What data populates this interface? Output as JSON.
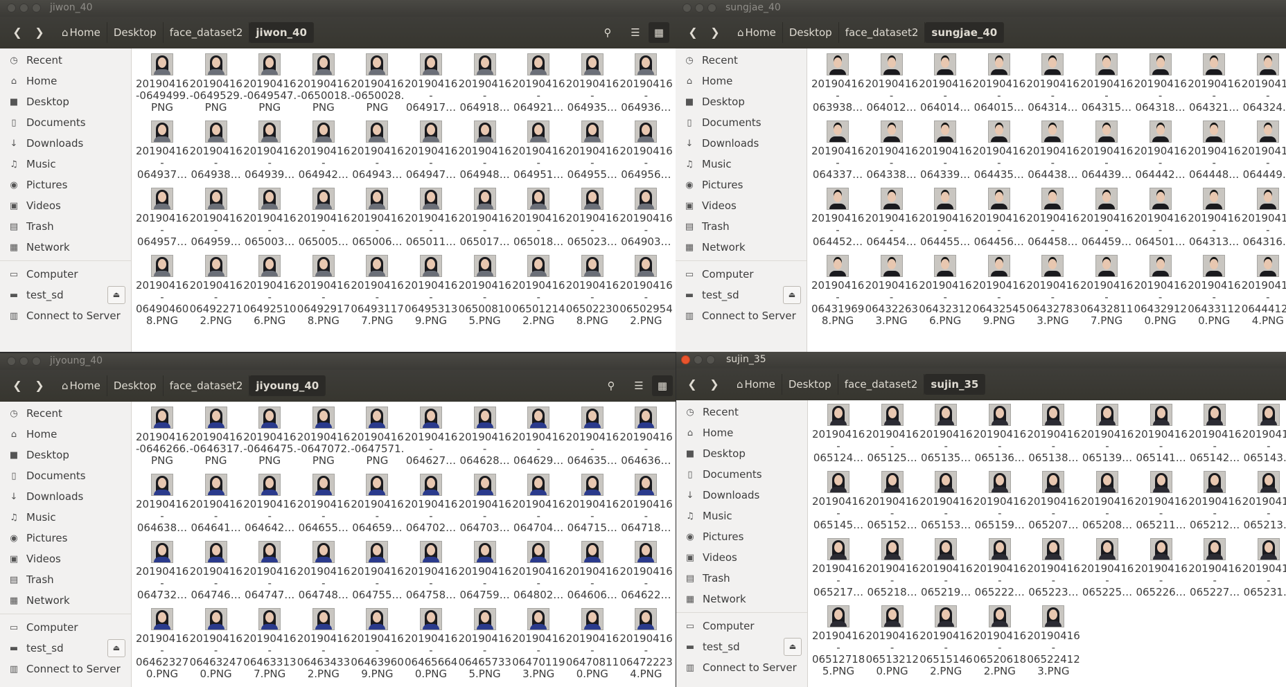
{
  "common": {
    "home_label": "Home",
    "desktop_label": "Desktop",
    "dataset_label": "face_dataset2",
    "sidebar": [
      "Recent",
      "Home",
      "Desktop",
      "Documents",
      "Downloads",
      "Music",
      "Pictures",
      "Videos",
      "Trash",
      "Network"
    ],
    "sidebar_icons": [
      "clock-icon",
      "home-icon",
      "folder-icon",
      "document-icon",
      "download-icon",
      "music-icon",
      "camera-icon",
      "video-icon",
      "trash-icon",
      "network-icon"
    ],
    "devices": [
      "Computer",
      "test_sd",
      "Connect to Server"
    ],
    "device_icons": [
      "computer-icon",
      "drive-icon",
      "server-icon"
    ]
  },
  "windows": [
    {
      "title": "jiwon_40",
      "folder": "jiwon_40",
      "files": [
        "20190416\n-0649499.\nPNG",
        "20190416\n-0649529.\nPNG",
        "20190416\n-0649547.\nPNG",
        "20190416\n-0650018.\nPNG",
        "20190416\n-0650028.\nPNG",
        "20190416\n-\n064917…",
        "20190416\n-\n064918…",
        "20190416\n-\n064921…",
        "20190416\n-\n064935…",
        "20190416\n-\n064936…",
        "20190416\n-\n064937…",
        "20190416\n-\n064938…",
        "20190416\n-\n064939…",
        "20190416\n-\n064942…",
        "20190416\n-\n064943…",
        "20190416\n-\n064947…",
        "20190416\n-\n064948…",
        "20190416\n-\n064951…",
        "20190416\n-\n064955…",
        "20190416\n-\n064956…",
        "20190416\n-\n064957…",
        "20190416\n-\n064959…",
        "20190416\n-\n065003…",
        "20190416\n-\n065005…",
        "20190416\n-\n065006…",
        "20190416\n-\n065011…",
        "20190416\n-\n065017…",
        "20190416\n-\n065018…",
        "20190416\n-\n065023…",
        "20190416\n-\n064903…",
        "20190416\n-\n06490460\n8.PNG",
        "20190416\n-\n06492271\n2.PNG",
        "20190416\n-\n06492510\n6.PNG",
        "20190416\n-\n06492917\n8.PNG",
        "20190416\n-\n06493117\n7.PNG",
        "20190416\n-\n06495313\n9.PNG",
        "20190416\n-\n06500810\n5.PNG",
        "20190416\n-\n06501214\n2.PNG",
        "20190416\n-\n06502230\n8.PNG",
        "20190416\n-\n06502954\n2.PNG"
      ]
    },
    {
      "title": "sungjae_40",
      "folder": "sungjae_40",
      "files": [
        "20190416\n-\n063938…",
        "20190416\n-\n064012…",
        "20190416\n-\n064014…",
        "20190416\n-\n064015…",
        "20190416\n-\n064314…",
        "20190416\n-\n064315…",
        "20190416\n-\n064318…",
        "20190416\n-\n064321…",
        "20190416\n-\n064324…",
        "20190416\n-\n064337…",
        "20190416\n-\n064338…",
        "20190416\n-\n064339…",
        "20190416\n-\n064435…",
        "20190416\n-\n064438…",
        "20190416\n-\n064439…",
        "20190416\n-\n064442…",
        "20190416\n-\n064448…",
        "20190416\n-\n064449…",
        "20190416\n-\n064452…",
        "20190416\n-\n064454…",
        "20190416\n-\n064455…",
        "20190416\n-\n064456…",
        "20190416\n-\n064458…",
        "20190416\n-\n064459…",
        "20190416\n-\n064501…",
        "20190416\n-\n064313…",
        "20190416\n-\n064316…",
        "20190416\n-\n06431969\n8.PNG",
        "20190416\n-\n06432263\n3.PNG",
        "20190416\n-\n06432312\n6.PNG",
        "20190416\n-\n06432545\n9.PNG",
        "20190416\n-\n06432783\n3.PNG",
        "20190416\n-\n06432811\n7.PNG",
        "20190416\n-\n06432912\n0.PNG",
        "20190416\n-\n06433112\n0.PNG",
        "20190416\n-\n06444122\n4.PNG"
      ]
    },
    {
      "title": "jiyoung_40",
      "folder": "jiyoung_40",
      "files": [
        "20190416\n-0646266.\nPNG",
        "20190416\n-0646317.\nPNG",
        "20190416\n-0646475.\nPNG",
        "20190416\n-0647072.\nPNG",
        "20190416\n-0647571.\nPNG",
        "20190416\n-\n064627…",
        "20190416\n-\n064628…",
        "20190416\n-\n064629…",
        "20190416\n-\n064635…",
        "20190416\n-\n064636…",
        "20190416\n-\n064638…",
        "20190416\n-\n064641…",
        "20190416\n-\n064642…",
        "20190416\n-\n064655…",
        "20190416\n-\n064659…",
        "20190416\n-\n064702…",
        "20190416\n-\n064703…",
        "20190416\n-\n064704…",
        "20190416\n-\n064715…",
        "20190416\n-\n064718…",
        "20190416\n-\n064732…",
        "20190416\n-\n064746…",
        "20190416\n-\n064747…",
        "20190416\n-\n064748…",
        "20190416\n-\n064755…",
        "20190416\n-\n064758…",
        "20190416\n-\n064759…",
        "20190416\n-\n064802…",
        "20190416\n-\n064606…",
        "20190416\n-\n064622…",
        "20190416\n-\n06462327\n0.PNG",
        "20190416\n-\n06463247\n0.PNG",
        "20190416\n-\n06463313\n7.PNG",
        "20190416\n-\n06463433\n2.PNG",
        "20190416\n-\n06463960\n9.PNG",
        "20190416\n-\n06465664\n0.PNG",
        "20190416\n-\n06465733\n5.PNG",
        "20190416\n-\n06470119\n3.PNG",
        "20190416\n-\n06470811\n0.PNG",
        "20190416\n-\n06472223\n4.PNG"
      ]
    },
    {
      "title": "sujin_35",
      "folder": "sujin_35",
      "files": [
        "20190416\n-\n065124…",
        "20190416\n-\n065125…",
        "20190416\n-\n065135…",
        "20190416\n-\n065136…",
        "20190416\n-\n065138…",
        "20190416\n-\n065139…",
        "20190416\n-\n065141…",
        "20190416\n-\n065142…",
        "20190416\n-\n065143…",
        "20190416\n-\n065145…",
        "20190416\n-\n065152…",
        "20190416\n-\n065153…",
        "20190416\n-\n065159…",
        "20190416\n-\n065207…",
        "20190416\n-\n065208…",
        "20190416\n-\n065211…",
        "20190416\n-\n065212…",
        "20190416\n-\n065213…",
        "20190416\n-\n065217…",
        "20190416\n-\n065218…",
        "20190416\n-\n065219…",
        "20190416\n-\n065222…",
        "20190416\n-\n065223…",
        "20190416\n-\n065225…",
        "20190416\n-\n065226…",
        "20190416\n-\n065227…",
        "20190416\n-\n065231…",
        "20190416\n-\n06512718\n5.PNG",
        "20190416\n-\n06513212\n0.PNG",
        "20190416\n-\n06515146\n2.PNG",
        "20190416\n-\n06520618\n2.PNG",
        "20190416\n-\n06522412\n3.PNG"
      ]
    }
  ],
  "colors": {
    "jiwon_shirt": "#6b6f78",
    "sungjae_shirt": "#1a1a1e",
    "jiyoung_shirt": "#2a3a8c",
    "sujin_shirt": "#2b2b33"
  }
}
